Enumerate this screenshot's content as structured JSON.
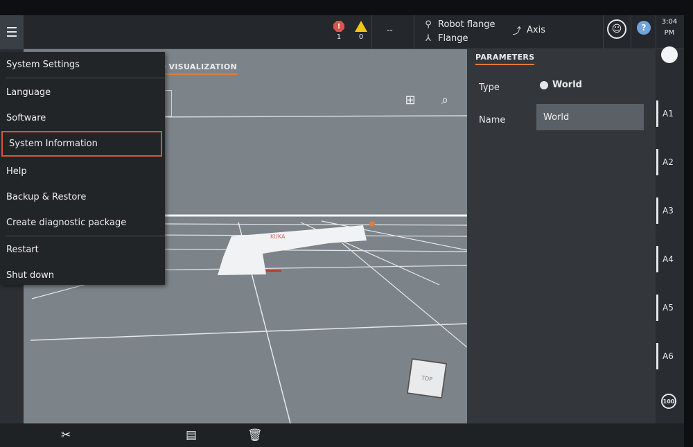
{
  "topbar": {
    "menu_icon": "hamburger-icon",
    "errors": "1",
    "warnings": "0",
    "status": "--",
    "tool_frame": "Robot flange",
    "base_frame": "Flange",
    "jog_mode": "Axis",
    "time": "3:04",
    "ampm": "PM",
    "help_label": "?"
  },
  "menu": {
    "items": [
      "System Settings",
      "Language",
      "Software",
      "System Information",
      "Help",
      "Backup & Restore",
      "Create diagnostic package",
      "Restart",
      "Shut down"
    ],
    "selected": "System Information"
  },
  "viewport": {
    "title": "D VISUALIZATION",
    "cube_label": "TOP",
    "robot_brand": "KUKA"
  },
  "parameters": {
    "title": "PARAMETERS",
    "type_label": "Type",
    "type_value": "World",
    "name_label": "Name",
    "name_value": "World"
  },
  "axes": [
    "A1",
    "A2",
    "A3",
    "A4",
    "A5",
    "A6"
  ],
  "override": "100",
  "colors": {
    "accent": "#e07b3a",
    "selection": "#d9533e",
    "error": "#d9534f",
    "warning": "#f0c419",
    "help": "#6fa3d9"
  }
}
